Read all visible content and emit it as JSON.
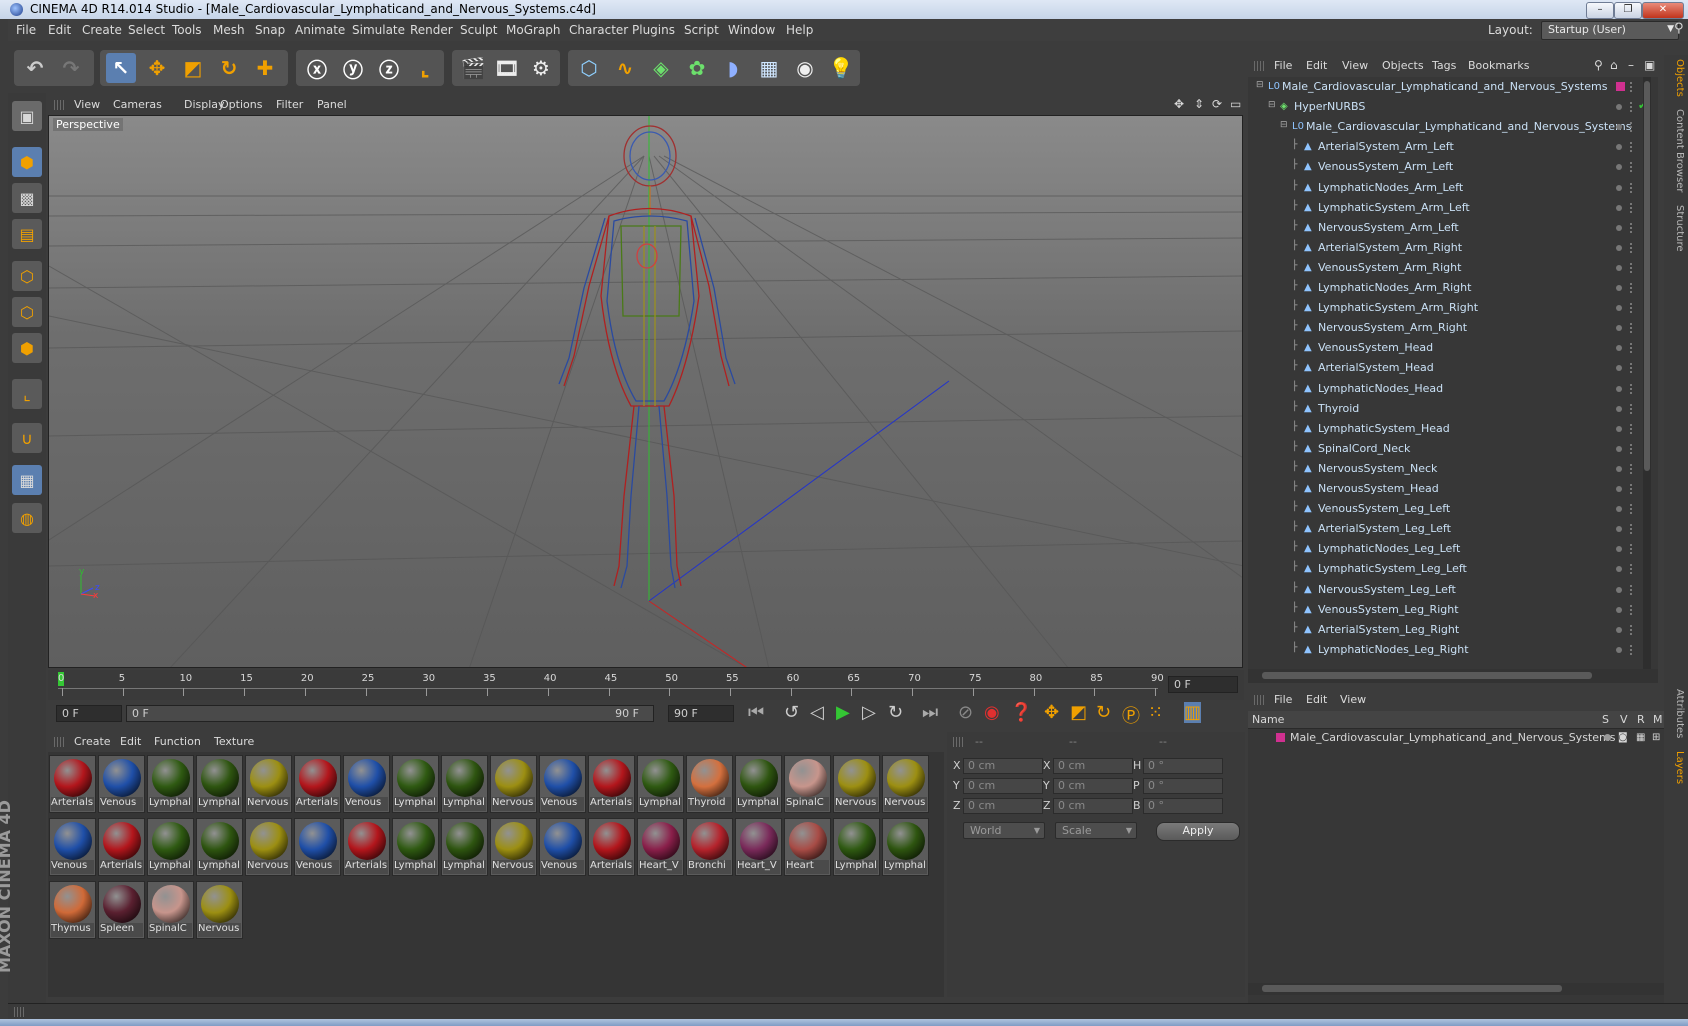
{
  "window": {
    "title": "CINEMA 4D R14.014 Studio - [Male_Cardiovascular_Lymphaticand_and_Nervous_Systems.c4d]",
    "min_label": "–",
    "max_label": "❐",
    "close_label": "✕"
  },
  "menubar": {
    "items": [
      "File",
      "Edit",
      "Create",
      "Select",
      "Tools",
      "Mesh",
      "Snap",
      "Animate",
      "Simulate",
      "Render",
      "Sculpt",
      "MoGraph",
      "Character",
      "Plugins",
      "Script",
      "Window",
      "Help"
    ],
    "layout_label": "Layout:",
    "layout_value": "Startup (User)"
  },
  "viewport": {
    "menu": [
      "View",
      "Cameras",
      "Display",
      "Options",
      "Filter",
      "Panel"
    ],
    "label": "Perspective",
    "axis_y": "y",
    "axis_z": "z",
    "axis_x": "x"
  },
  "timeline": {
    "ticks": [
      "0",
      "5",
      "10",
      "15",
      "20",
      "25",
      "30",
      "35",
      "40",
      "45",
      "50",
      "55",
      "60",
      "65",
      "70",
      "75",
      "80",
      "85",
      "90"
    ],
    "current_frame": "0 F"
  },
  "transport": {
    "start_field": "0 F",
    "range_start": "0 F",
    "range_end": "90 F",
    "end_field": "90 F"
  },
  "material_manager": {
    "menu": [
      "Create",
      "Edit",
      "Function",
      "Texture"
    ],
    "materials": [
      {
        "label": "Arterials",
        "color": "#b3161c"
      },
      {
        "label": "Venous",
        "color": "#1f4fa8"
      },
      {
        "label": "Lymphal",
        "color": "#2f5a12"
      },
      {
        "label": "Lymphal",
        "color": "#2e5510"
      },
      {
        "label": "Nervous",
        "color": "#9c8f12"
      },
      {
        "label": "Arterials",
        "color": "#b3161c"
      },
      {
        "label": "Venous",
        "color": "#1f4fa8"
      },
      {
        "label": "Lymphal",
        "color": "#2f5a12"
      },
      {
        "label": "Lymphal",
        "color": "#2e5510"
      },
      {
        "label": "Nervous",
        "color": "#9c8f12"
      },
      {
        "label": "Venous",
        "color": "#1f4fa8"
      },
      {
        "label": "Arterials",
        "color": "#b3161c"
      },
      {
        "label": "Lymphal",
        "color": "#2f5a12"
      },
      {
        "label": "Thyroid",
        "color": "#d4703e"
      },
      {
        "label": "Lymphal",
        "color": "#2e5510"
      },
      {
        "label": "SpinalC",
        "color": "#c7958c"
      },
      {
        "label": "Nervous",
        "color": "#9c8f12"
      },
      {
        "label": "Nervous",
        "color": "#9c8f12"
      },
      {
        "label": "Venous",
        "color": "#1f4fa8"
      },
      {
        "label": "Arterials",
        "color": "#b3161c"
      },
      {
        "label": "Lymphal",
        "color": "#2f5a12"
      },
      {
        "label": "Lymphal",
        "color": "#2e5510"
      },
      {
        "label": "Nervous",
        "color": "#9c8f12"
      },
      {
        "label": "Venous",
        "color": "#1f4fa8"
      },
      {
        "label": "Arterials",
        "color": "#b3161c"
      },
      {
        "label": "Lymphal",
        "color": "#2f5a12"
      },
      {
        "label": "Lymphal",
        "color": "#2e5510"
      },
      {
        "label": "Nervous",
        "color": "#9c8f12"
      },
      {
        "label": "Venous",
        "color": "#1f4fa8"
      },
      {
        "label": "Arterials",
        "color": "#b3161c"
      },
      {
        "label": "Heart_V",
        "color": "#8a1f4a"
      },
      {
        "label": "Bronchi",
        "color": "#b5232c"
      },
      {
        "label": "Heart_V",
        "color": "#7a2a5a"
      },
      {
        "label": "Heart",
        "color": "#a84c46"
      },
      {
        "label": "Lymphal",
        "color": "#2f5a12"
      },
      {
        "label": "Lymphal",
        "color": "#2e5510"
      },
      {
        "label": "Thymus",
        "color": "#d06a38"
      },
      {
        "label": "Spleen",
        "color": "#5a2030"
      },
      {
        "label": "SpinalC",
        "color": "#c7958c"
      },
      {
        "label": "Nervous",
        "color": "#9c8f12"
      }
    ]
  },
  "coordinates": {
    "header": [
      "--",
      "--",
      "--"
    ],
    "rows": [
      {
        "a": "X",
        "av": "0 cm",
        "b": "X",
        "bv": "0 cm",
        "c": "H",
        "cv": "0 °"
      },
      {
        "a": "Y",
        "av": "0 cm",
        "b": "Y",
        "bv": "0 cm",
        "c": "P",
        "cv": "0 °"
      },
      {
        "a": "Z",
        "av": "0 cm",
        "b": "Z",
        "bv": "0 cm",
        "c": "B",
        "cv": "0 °"
      }
    ],
    "world": "World",
    "scale": "Scale",
    "apply": "Apply"
  },
  "object_manager": {
    "menu": [
      "File",
      "Edit",
      "View",
      "Objects",
      "Tags",
      "Bookmarks"
    ],
    "objects": [
      {
        "label": "Male_Cardiovascular_Lymphaticand_and_Nervous_Systems",
        "indent": 0
      },
      {
        "label": "HyperNURBS",
        "indent": 1
      },
      {
        "label": "Male_Cardiovascular_Lymphaticand_and_Nervous_Systems",
        "indent": 2
      },
      {
        "label": "ArterialSystem_Arm_Left",
        "indent": 3
      },
      {
        "label": "VenousSystem_Arm_Left",
        "indent": 3
      },
      {
        "label": "LymphaticNodes_Arm_Left",
        "indent": 3
      },
      {
        "label": "LymphaticSystem_Arm_Left",
        "indent": 3
      },
      {
        "label": "NervousSystem_Arm_Left",
        "indent": 3
      },
      {
        "label": "ArterialSystem_Arm_Right",
        "indent": 3
      },
      {
        "label": "VenousSystem_Arm_Right",
        "indent": 3
      },
      {
        "label": "LymphaticNodes_Arm_Right",
        "indent": 3
      },
      {
        "label": "LymphaticSystem_Arm_Right",
        "indent": 3
      },
      {
        "label": "NervousSystem_Arm_Right",
        "indent": 3
      },
      {
        "label": "VenousSystem_Head",
        "indent": 3
      },
      {
        "label": "ArterialSystem_Head",
        "indent": 3
      },
      {
        "label": "LymphaticNodes_Head",
        "indent": 3
      },
      {
        "label": "Thyroid",
        "indent": 3
      },
      {
        "label": "LymphaticSystem_Head",
        "indent": 3
      },
      {
        "label": "SpinalCord_Neck",
        "indent": 3
      },
      {
        "label": "NervousSystem_Neck",
        "indent": 3
      },
      {
        "label": "NervousSystem_Head",
        "indent": 3
      },
      {
        "label": "VenousSystem_Leg_Left",
        "indent": 3
      },
      {
        "label": "ArterialSystem_Leg_Left",
        "indent": 3
      },
      {
        "label": "LymphaticNodes_Leg_Left",
        "indent": 3
      },
      {
        "label": "LymphaticSystem_Leg_Left",
        "indent": 3
      },
      {
        "label": "NervousSystem_Leg_Left",
        "indent": 3
      },
      {
        "label": "VenousSystem_Leg_Right",
        "indent": 3
      },
      {
        "label": "ArterialSystem_Leg_Right",
        "indent": 3
      },
      {
        "label": "LymphaticNodes_Leg_Right",
        "indent": 3
      }
    ]
  },
  "layer_manager": {
    "menu": [
      "File",
      "Edit",
      "View"
    ],
    "col_name": "Name",
    "cols": [
      "S",
      "V",
      "R",
      "M"
    ],
    "layers": [
      {
        "label": "Male_Cardiovascular_Lymphaticand_and_Nervous_Systems",
        "color": "#d03090"
      }
    ]
  },
  "right_tabs": [
    "Objects",
    "Content Browser",
    "Structure",
    "Attributes",
    "Layers"
  ],
  "branding": {
    "logo_text": "MAXON CINEMA 4D"
  },
  "colors": {
    "accent": "#f0a000",
    "selected": "#5b7fb0",
    "play": "#34c734"
  }
}
